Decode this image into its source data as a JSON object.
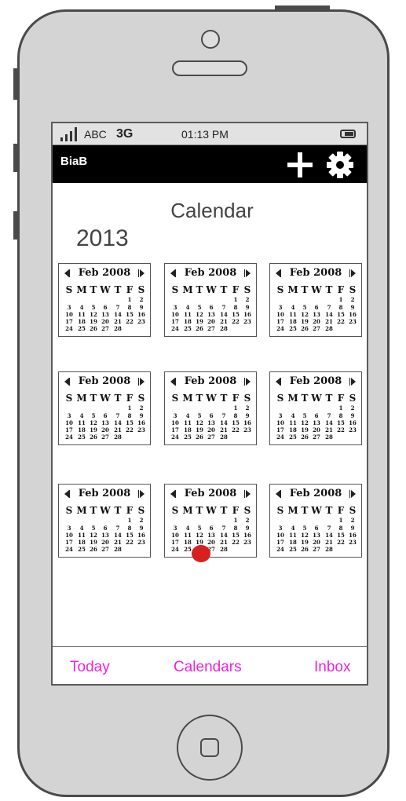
{
  "status_bar": {
    "carrier": "ABC",
    "network": "3G",
    "time": "01:13 PM"
  },
  "app_bar": {
    "title": "BiaB",
    "add_icon": "plus-icon",
    "settings_icon": "gear-icon"
  },
  "page": {
    "title": "Calendar",
    "year": "2013"
  },
  "mini_calendar": {
    "title": "Feb 2008",
    "weekdays": [
      "S",
      "M",
      "T",
      "W",
      "T",
      "F",
      "S"
    ],
    "weeks": [
      [
        "",
        "",
        "",
        "",
        "",
        "1",
        "2"
      ],
      [
        "3",
        "4",
        "5",
        "6",
        "7",
        "8",
        "9"
      ],
      [
        "10",
        "11",
        "12",
        "13",
        "14",
        "15",
        "16"
      ],
      [
        "17",
        "18",
        "19",
        "20",
        "21",
        "22",
        "23"
      ],
      [
        "24",
        "25",
        "26",
        "27",
        "28",
        "",
        ""
      ]
    ]
  },
  "calendars": [
    {
      "title": "Feb 2008"
    },
    {
      "title": "Feb 2008"
    },
    {
      "title": "Feb 2008"
    },
    {
      "title": "Feb 2008"
    },
    {
      "title": "Feb 2008"
    },
    {
      "title": "Feb 2008"
    },
    {
      "title": "Feb 2008"
    },
    {
      "title": "Feb 2008"
    },
    {
      "title": "Feb 2008"
    }
  ],
  "highlight": {
    "calendar_index": 7,
    "color": "#d92020"
  },
  "tab_bar": {
    "today": "Today",
    "calendars": "Calendars",
    "inbox": "Inbox",
    "color": "#ee22dd"
  }
}
